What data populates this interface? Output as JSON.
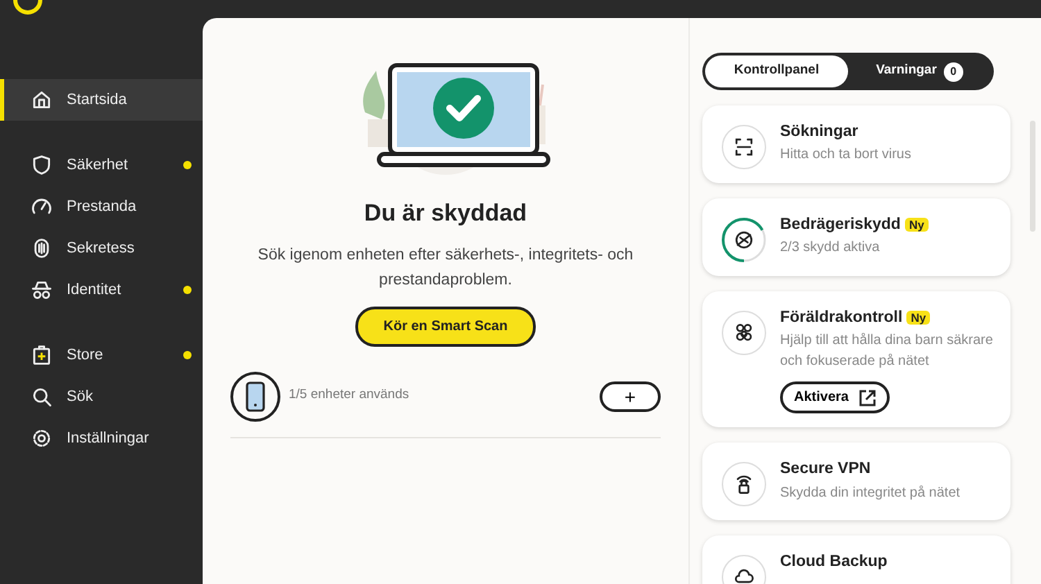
{
  "sidebar": {
    "items": [
      {
        "kind": "home",
        "label": "Startsida",
        "selected": true,
        "alert": false
      },
      {
        "kind": "shield",
        "label": "Säkerhet",
        "selected": false,
        "alert": true
      },
      {
        "kind": "gauge",
        "label": "Prestanda",
        "selected": false,
        "alert": false
      },
      {
        "kind": "fingerprint",
        "label": "Sekretess",
        "selected": false,
        "alert": false
      },
      {
        "kind": "spy",
        "label": "Identitet",
        "selected": false,
        "alert": true
      },
      {
        "kind": "store",
        "label": "Store",
        "selected": false,
        "alert": true
      },
      {
        "kind": "search",
        "label": "Sök",
        "selected": false,
        "alert": false
      },
      {
        "kind": "gear",
        "label": "Inställningar",
        "selected": false,
        "alert": false
      }
    ]
  },
  "status": {
    "title": "Du är skyddad",
    "description": "Sök igenom enheten efter säkerhets-, integritets- och prestandaproblem.",
    "scan_button": "Kör en Smart Scan",
    "devices": "1/5 enheter används",
    "add_button": "+"
  },
  "panel": {
    "tabs": [
      {
        "label": "Kontrollpanel",
        "selected": true
      },
      {
        "label": "Varningar",
        "selected": false,
        "count": "0"
      }
    ],
    "cards": [
      {
        "kind": "scan",
        "title": "Sökningar",
        "subtitle": "Hitta och ta bort virus"
      },
      {
        "kind": "scam",
        "title": "Bedrägeriskydd",
        "badge": "Ny",
        "subtitle": "2/3 skydd aktiva"
      },
      {
        "kind": "family",
        "title": "Föräldrakontroll",
        "badge": "Ny",
        "subtitle": "Hjälp till att hålla dina barn säkrare och fokuserade på nätet",
        "button": "Aktivera"
      },
      {
        "kind": "vpn",
        "title": "Secure VPN",
        "subtitle": "Skydda din integritet på nätet"
      },
      {
        "kind": "backup",
        "title": "Cloud Backup"
      }
    ]
  }
}
